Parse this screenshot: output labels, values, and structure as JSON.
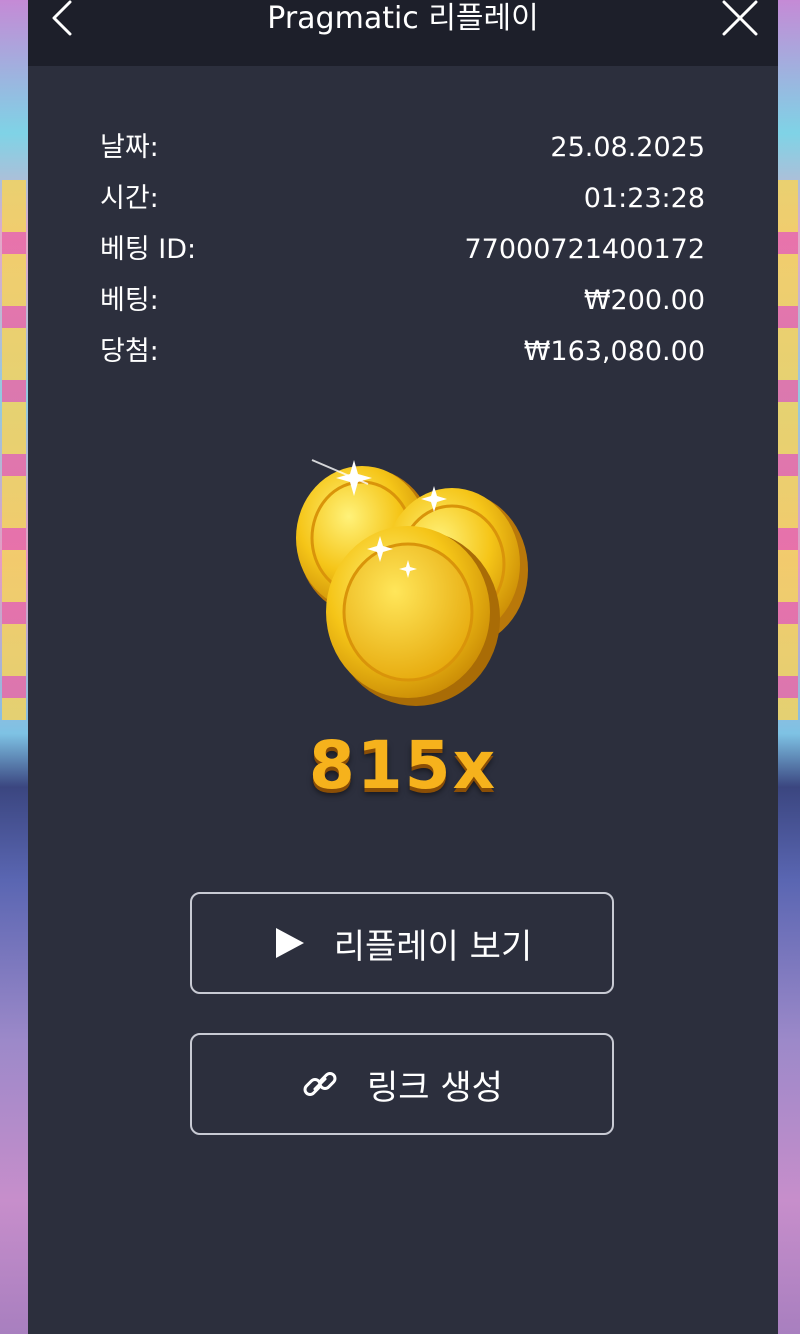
{
  "header": {
    "title": "Pragmatic 리플레이"
  },
  "details": [
    {
      "label": "날짜:",
      "value": "25.08.2025"
    },
    {
      "label": "시간:",
      "value": "01:23:28"
    },
    {
      "label": "베팅 ID:",
      "value": "77000721400172"
    },
    {
      "label": "베팅:",
      "value": "₩200.00"
    },
    {
      "label": "당첨:",
      "value": "₩163,080.00"
    }
  ],
  "win": {
    "multiplier": "815x"
  },
  "buttons": {
    "replay_label": "리플레이 보기",
    "link_label": "링크 생성"
  },
  "icons": {
    "back": "chevron-left-icon",
    "close": "close-icon",
    "play": "play-icon",
    "link": "link-icon",
    "coins": "gold-coins-icon"
  },
  "colors": {
    "panel": "#2c2f3d",
    "header": "#1d1f2a",
    "multiplier": "#f6b21c",
    "coin": "#f5c518"
  }
}
